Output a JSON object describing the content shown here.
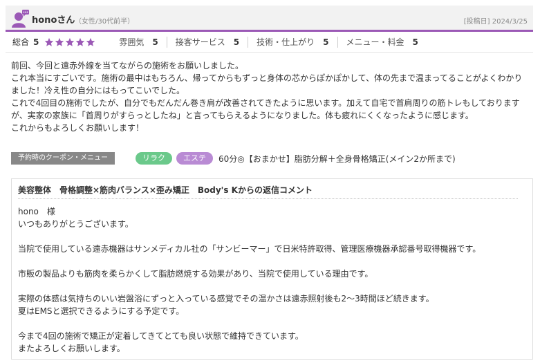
{
  "review": {
    "user_name": "honoさん",
    "user_meta": "（女性/30代前半）",
    "post_date": "[投稿日] 2024/3/25",
    "overall_label": "総合",
    "overall_score": "5",
    "stars": 5,
    "categories": [
      {
        "label": "雰囲気",
        "score": "5"
      },
      {
        "label": "接客サービス",
        "score": "5"
      },
      {
        "label": "技術・仕上がり",
        "score": "5"
      },
      {
        "label": "メニュー・料金",
        "score": "5"
      }
    ],
    "body_lines": [
      "前回、今回と遠赤外線を当てながらの施術をお願いしました。",
      "これ本当にすごいです。施術の最中はもちろん、帰ってからもずっと身体の芯からぽかぽかして、体の先まで温まってることがよくわかりました！冷え性の自分にはもってこいでした。",
      "これで4回目の施術でしたが、自分でもだんだん巻き肩が改善されてきたように思います。加えて自宅で首肩周りの筋トレもしておりますが、実家の家族に「首周りがすらっとしたね」と言ってもらえるようになりました。体も疲れにくくなったように感じます。",
      "これからもよろしくお願いします！"
    ]
  },
  "coupon": {
    "label": "予約時のクーポン・メニュー",
    "tag_relax": "リラク",
    "tag_este": "エステ",
    "text": "60分◎【おまかせ】脂肪分解＋全身骨格矯正(メイン2か所まで)"
  },
  "reply": {
    "title": "美容整体　骨格調整×筋肉バランス×歪み矯正　Body's Kからの返信コメント",
    "lines": [
      "hono　様",
      "いつもありがとうございます。",
      "",
      "当院で使用している遠赤機器はサンメディカル社の「サンビーマー」で日米特許取得、管理医療機器承認番号取得機器です。",
      "",
      "市販の製品よりも筋肉を柔らかくして脂肪燃焼する効果があり、当院で使用している理由です。",
      "",
      "実際の体感は気持ちのいい岩盤浴にずっと入っている感覚でその温かさは遠赤照射後も2〜3時間ほど続きます。",
      "夏はEMSと選択できるようにする予定です。",
      "",
      "今まで4回の施術で矯正が定着してきてとても良い状態で維持できています。",
      "またよろしくお願いします。"
    ]
  },
  "colors": {
    "accent": "#9b59b6",
    "star": "#9b59b6",
    "tag_relax": "#6bc98b",
    "tag_este": "#b98bd4"
  }
}
